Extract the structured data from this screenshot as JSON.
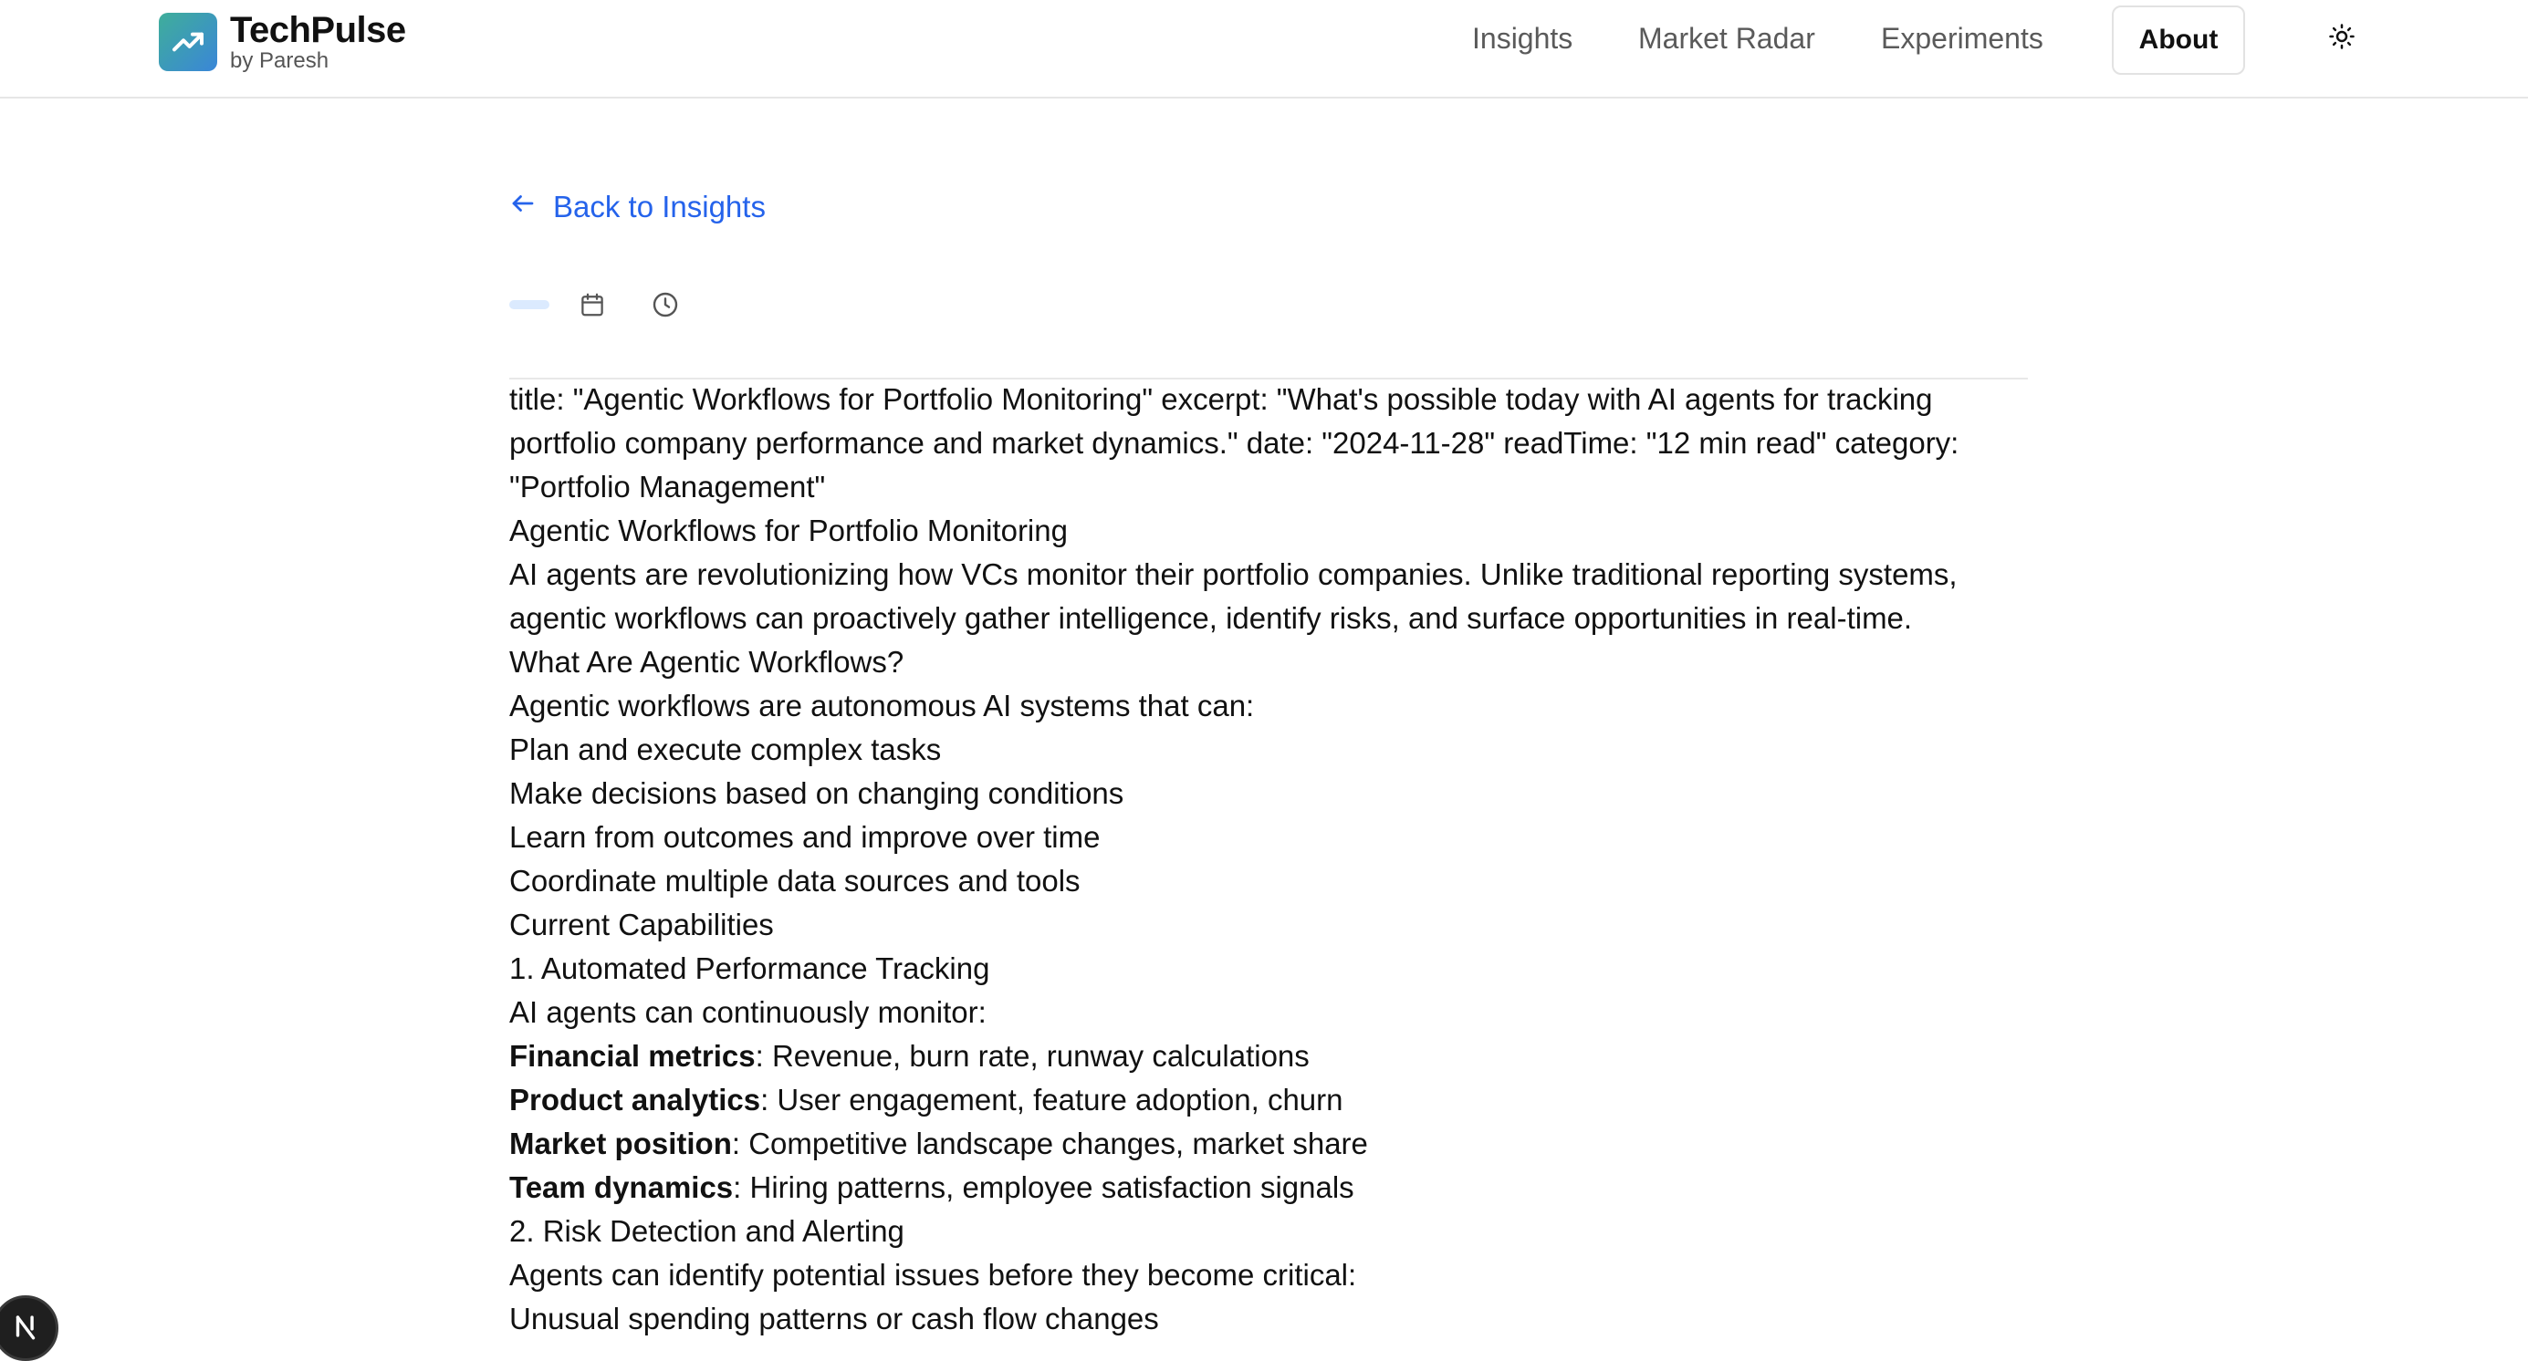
{
  "brand": {
    "name": "TechPulse",
    "subtitle": "by Paresh",
    "logo_icon": "trending-up-icon",
    "logo_gradient": [
      "#3fae9a",
      "#3a86d8"
    ]
  },
  "nav": {
    "items": [
      {
        "label": "Insights"
      },
      {
        "label": "Market Radar"
      },
      {
        "label": "Experiments"
      }
    ],
    "about_label": "About",
    "theme_icon": "sun-icon"
  },
  "back": {
    "label": "Back to Insights",
    "icon": "arrow-left-icon",
    "color": "#2563eb"
  },
  "meta": {
    "category": "",
    "date": "",
    "read_time": "",
    "pill_color": "#dbeafe"
  },
  "article": {
    "frontmatter": "title: \"Agentic Workflows for Portfolio Monitoring\" excerpt: \"What's possible today with AI agents for tracking portfolio company performance and market dynamics.\" date: \"2024-11-28\" readTime: \"12 min read\" category: \"Portfolio Management\"",
    "heading": "Agentic Workflows for Portfolio Monitoring",
    "intro": "AI agents are revolutionizing how VCs monitor their portfolio companies. Unlike traditional reporting systems, agentic workflows can proactively gather intelligence, identify risks, and surface opportunities in real-time.",
    "section1_title": "What Are Agentic Workflows?",
    "section1_lead": "Agentic workflows are autonomous AI systems that can:",
    "capabilities": [
      "Plan and execute complex tasks",
      "Make decisions based on changing conditions",
      "Learn from outcomes and improve over time",
      "Coordinate multiple data sources and tools"
    ],
    "section2_title": "Current Capabilities",
    "sub1_title": "1. Automated Performance Tracking",
    "sub1_lead": "AI agents can continuously monitor:",
    "monitor_items": [
      {
        "term": "Financial metrics",
        "desc": ": Revenue, burn rate, runway calculations"
      },
      {
        "term": "Product analytics",
        "desc": ": User engagement, feature adoption, churn"
      },
      {
        "term": "Market position",
        "desc": ": Competitive landscape changes, market share"
      },
      {
        "term": "Team dynamics",
        "desc": ": Hiring patterns, employee satisfaction signals"
      }
    ],
    "sub2_title": "2. Risk Detection and Alerting",
    "sub2_lead": "Agents can identify potential issues before they become critical:",
    "risk_items": [
      "Unusual spending patterns or cash flow changes"
    ]
  },
  "badge": {
    "letter": "N",
    "icon": "nextjs-icon"
  }
}
